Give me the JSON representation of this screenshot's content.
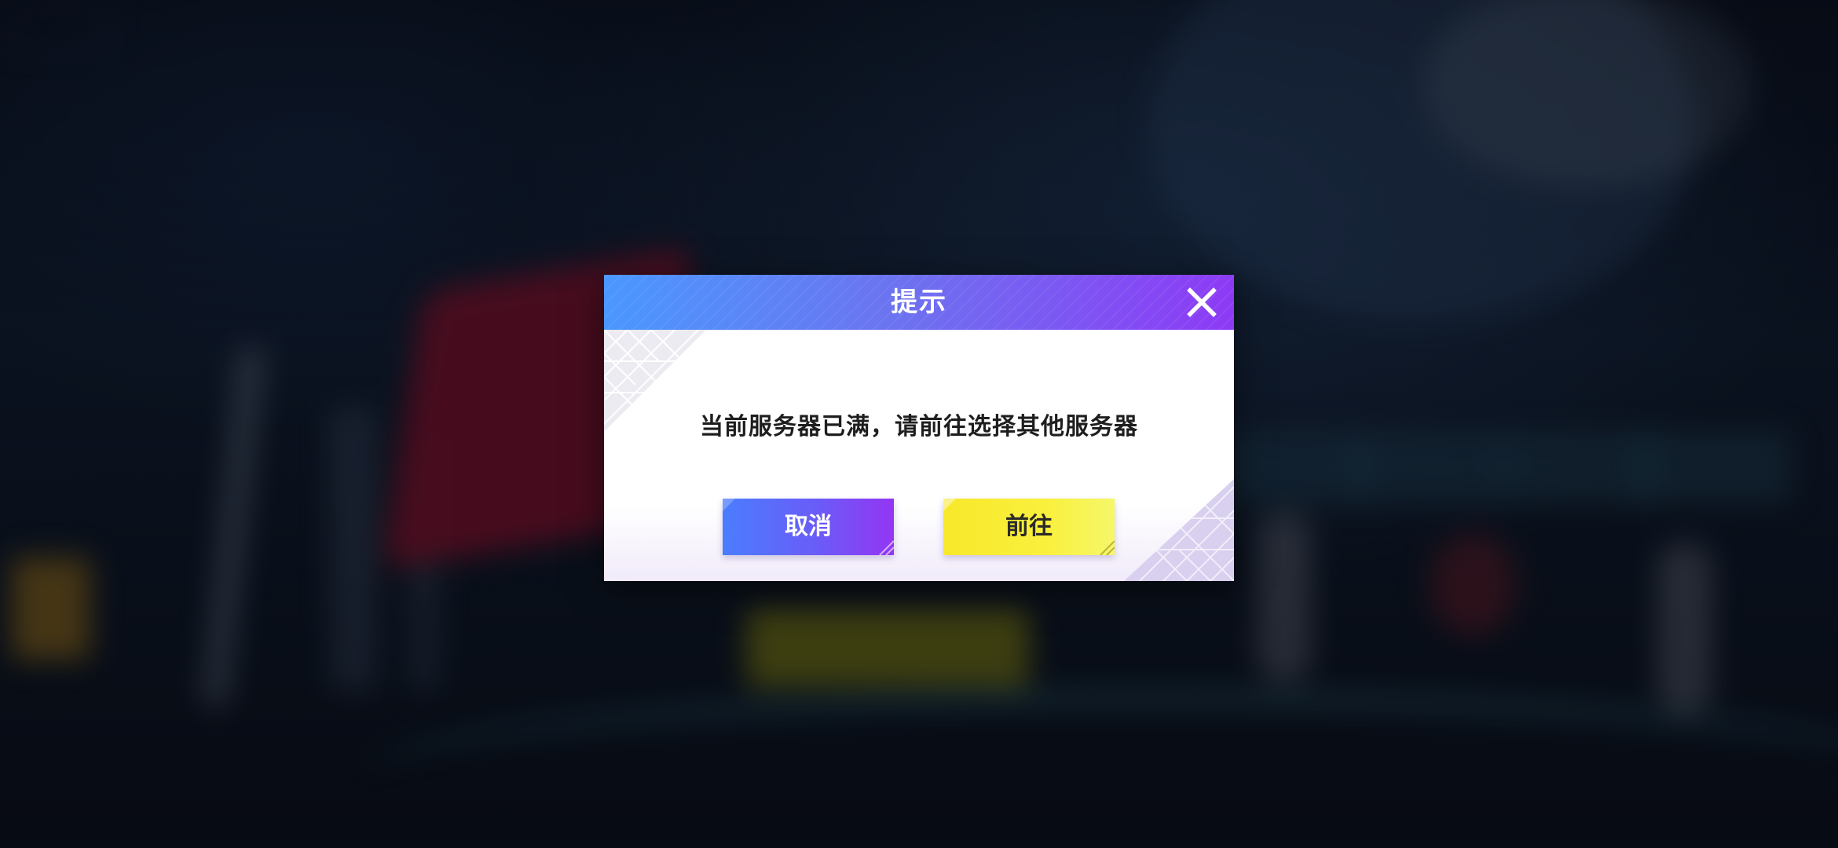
{
  "dialog": {
    "title": "提示",
    "message": "当前服务器已满，请前往选择其他服务器",
    "cancel_label": "取消",
    "go_label": "前往",
    "close_icon": "close-icon"
  },
  "colors": {
    "header_start": "#4a98ff",
    "header_end": "#8d3af5",
    "cancel_start": "#4a7dff",
    "cancel_end": "#9435f4",
    "go_color": "#f8e82b",
    "message_color": "#1e1e1e"
  }
}
